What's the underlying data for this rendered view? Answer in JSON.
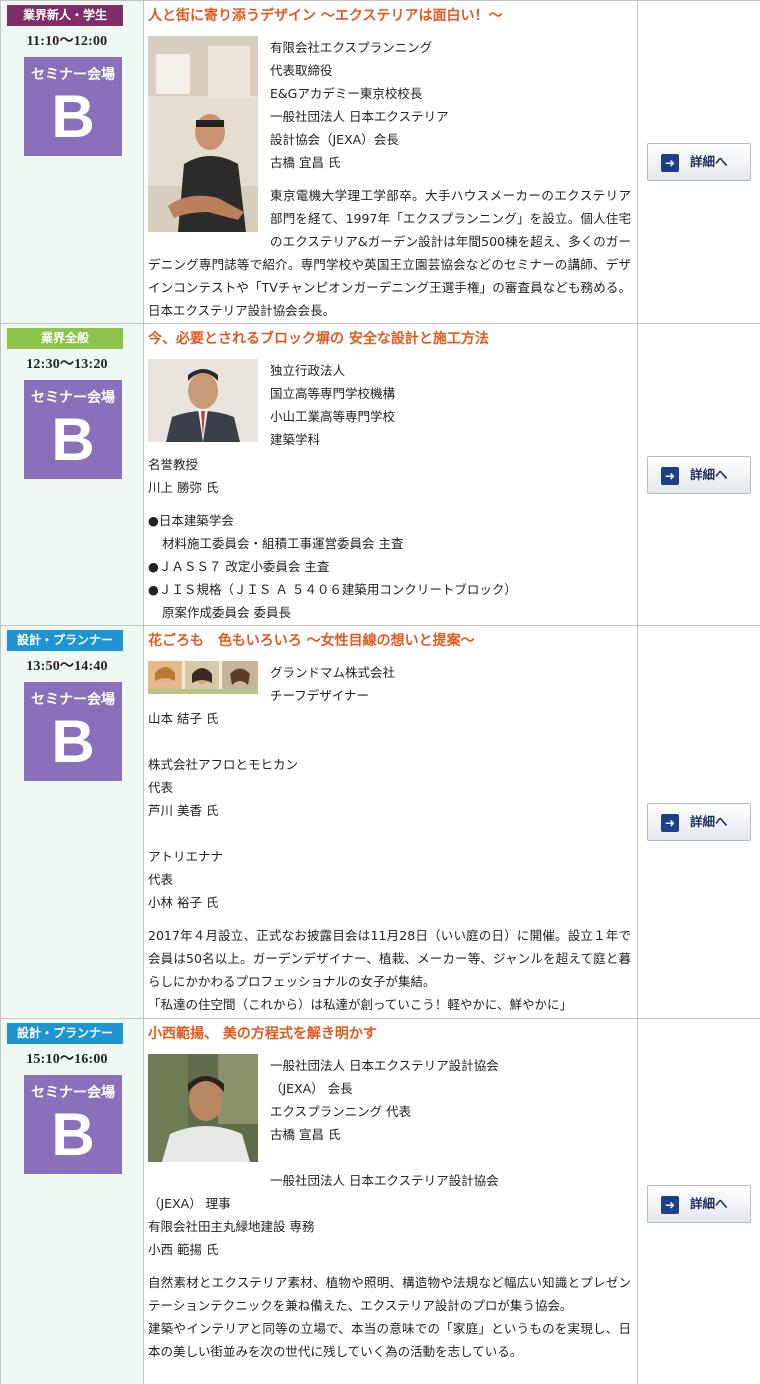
{
  "rows": [
    {
      "category": "業界新人・学生",
      "category_color": "#7d2e66",
      "time": "11:10～12:00",
      "venue_label": "セミナー会場",
      "venue_letter": "B",
      "title": "人と街に寄り添うデザイン ～エクステリアは面白い！～",
      "lines_beside_photo": [
        "有限会社エクスプランニング",
        "代表取締役",
        "E&Gアカデミー東京校校長",
        "一般社団法人 日本エクステリア",
        "設計協会（JEXA）会長",
        "古橋 宜昌 氏"
      ],
      "description": "東京電機大学理工学部卒。大手ハウスメーカーのエクステリア部門を経て、1997年「エクスプランニング」を設立。個人住宅のエクステリア&ガーデン設計は年間500棟を超え、多くのガーデニング専門誌等で紹介。専門学校や英国王立園芸協会などのセミナーの講師、デザインコンテストや「TVチャンピオンガーデニング王選手権」の審査員なども務める。日本エクステリア設計協会会長。",
      "button_label": "詳細へ"
    },
    {
      "category": "業界全般",
      "category_color": "#8dc34a",
      "time": "12:30～13:20",
      "venue_label": "セミナー会場",
      "venue_letter": "B",
      "title": "今、必要とされるブロック塀の 安全な設計と施工方法",
      "lines_beside_photo": [
        "独立行政法人",
        "国立高等専門学校機構",
        "小山工業高等専門学校",
        "建築学科"
      ],
      "lines_below_photo": [
        "名誉教授",
        "川上 勝弥 氏"
      ],
      "bullets": [
        {
          "main": "●日本建築学会",
          "sub": "材料施工委員会・組積工事運営委員会 主査"
        },
        {
          "main": "●ＪＡＳＳ７ 改定小委員会 主査",
          "sub": ""
        },
        {
          "main": "●ＪＩＳ規格（ＪＩＳ Ａ ５４０６建築用コンクリートブロック）",
          "sub": "原案作成委員会 委員長"
        }
      ],
      "button_label": "詳細へ"
    },
    {
      "category": "設計・プランナー",
      "category_color": "#1e94d2",
      "time": "13:50～14:40",
      "venue_label": "セミナー会場",
      "venue_letter": "B",
      "title": "花ごろも　色もいろいろ ～女性目線の想いと提案～",
      "lines_beside_photo": [
        "グランドマム株式会社",
        "チーフデザイナー"
      ],
      "lines_below_photo": [
        "山本 結子 氏",
        "",
        "株式会社アフロとモヒカン",
        "代表",
        "芦川 美香 氏",
        "",
        "アトリエナナ",
        "代表",
        "小林 裕子 氏"
      ],
      "description_lines": [
        "2017年４月設立、正式なお披露目会は11月28日（いい庭の日）に開催。設立１年で会員は50名以上。ガーデンデザイナー、植栽、メーカー等、ジャンルを超えて庭と暮らしにかかわるプロフェッショナルの女子が集結。",
        "「私達の住空間（これから）は私達が創っていこう！軽やかに、鮮やかに」"
      ],
      "button_label": "詳細へ"
    },
    {
      "category": "設計・プランナー",
      "category_color": "#1e94d2",
      "time": "15:10～16:00",
      "venue_label": "セミナー会場",
      "venue_letter": "B",
      "title": "小西範揚、 美の方程式を解き明かす",
      "lines_beside_photo": [
        "一般社団法人 日本エクステリア設計協会",
        "（JEXA） 会長",
        "エクスプランニング 代表",
        "古橋 宣昌 氏",
        "",
        "一般社団法人 日本エクステリア設計協会"
      ],
      "lines_below_photo": [
        "（JEXA） 理事",
        "有限会社田主丸緑地建設 専務",
        "小西 範揚 氏"
      ],
      "description_lines": [
        "自然素材とエクステリア素材、植物や照明、構造物や法規など幅広い知識とプレゼンテーションテクニックを兼ね備えた、エクステリア設計のプロが集う協会。",
        "建築やインテリアと同等の立場で、本当の意味での「家庭」というものを実現し、日本の美しい街並みを次の世代に残していく為の活動を志している。"
      ],
      "button_label": "詳細へ"
    }
  ]
}
